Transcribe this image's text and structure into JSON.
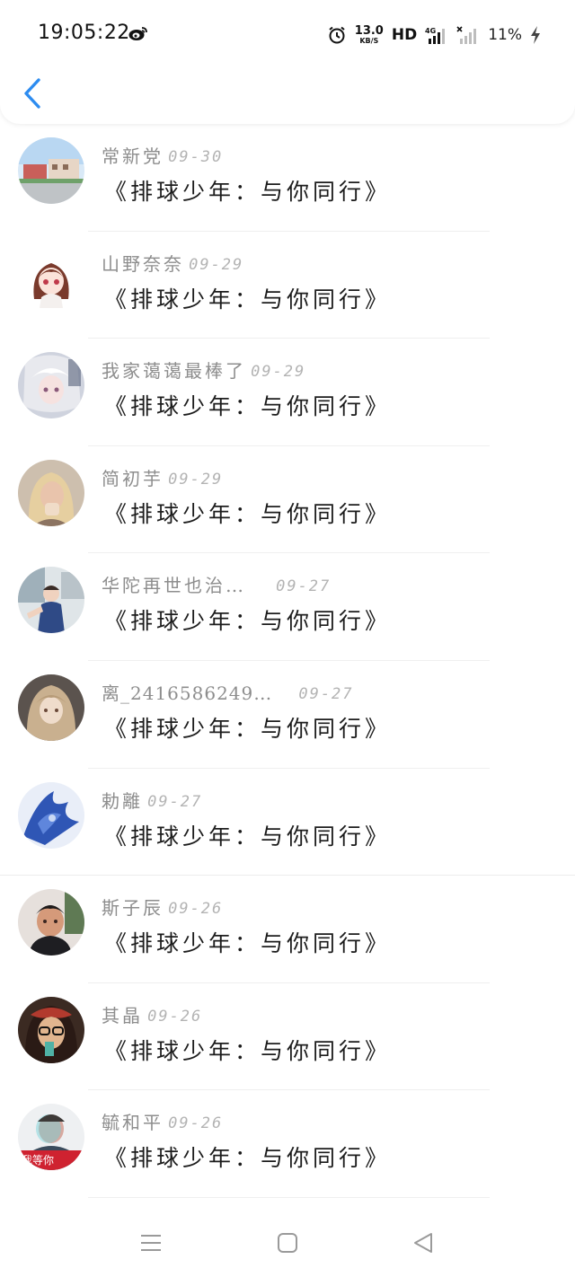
{
  "status_bar": {
    "time": "19:05:22",
    "net_speed_value": "13.0",
    "net_speed_unit": "KB/S",
    "hd": "HD",
    "network": "4G",
    "battery": "11%",
    "icons": [
      "weibo-icon",
      "alarm-icon",
      "signal-icon",
      "bolt-icon"
    ]
  },
  "header": {
    "back_icon": "chevron-left-icon",
    "accent": "#2d8cf0"
  },
  "items": [
    {
      "name": "常新党",
      "date": "09-30",
      "title": "《排球少年：与你同行》"
    },
    {
      "name": "山野奈奈",
      "date": "09-29",
      "title": "《排球少年：与你同行》"
    },
    {
      "name": "我家蔼蔼最棒了",
      "date": "09-29",
      "title": "《排球少年：与你同行》"
    },
    {
      "name": "简初芋",
      "date": "09-29",
      "title": "《排球少年：与你同行》"
    },
    {
      "name": "华陀再世也治…",
      "date": "09-27",
      "title": "《排球少年：与你同行》"
    },
    {
      "name": "离_2416586249…",
      "date": "09-27",
      "title": "《排球少年：与你同行》"
    },
    {
      "name": "勅離",
      "date": "09-27",
      "title": "《排球少年：与你同行》"
    },
    {
      "name": "斯子辰",
      "date": "09-26",
      "title": "《排球少年：与你同行》"
    },
    {
      "name": "其晶",
      "date": "09-26",
      "title": "《排球少年：与你同行》"
    },
    {
      "name": "毓和平",
      "date": "09-26",
      "title": "《排球少年：与你同行》",
      "avatar_caption": "我等你"
    }
  ],
  "nav": {
    "icons": [
      "menu-icon",
      "home-square-icon",
      "back-triangle-icon"
    ]
  }
}
